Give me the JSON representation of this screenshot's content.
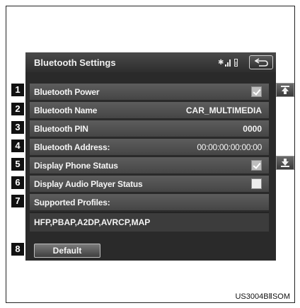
{
  "screen": {
    "title": "Bluetooth Settings",
    "status_icons": [
      "bluetooth-icon",
      "signal-icon",
      "battery-icon"
    ],
    "back_icon": "back-arrow-icon"
  },
  "rows": [
    {
      "num": "1",
      "label": "Bluetooth Power",
      "type": "checkbox",
      "checked": true
    },
    {
      "num": "2",
      "label": "Bluetooth Name",
      "type": "value",
      "value": "CAR_MULTIMEDIA"
    },
    {
      "num": "3",
      "label": "Bluetooth PIN",
      "type": "value",
      "value": "0000"
    },
    {
      "num": "4",
      "label": "Bluetooth Address:",
      "type": "value",
      "value": "00:00:00:00:00:00"
    },
    {
      "num": "5",
      "label": "Display Phone Status",
      "type": "checkbox",
      "checked": true
    },
    {
      "num": "6",
      "label": "Display Audio Player Status",
      "type": "checkbox",
      "checked": false
    },
    {
      "num": "7",
      "label": "Supported Profiles:",
      "type": "header"
    }
  ],
  "profiles_value": "HFP,PBAP,A2DP,AVRCP,MAP",
  "default_button": {
    "num": "8",
    "label": "Default"
  },
  "scroll": {
    "up_icon": "scroll-up-icon",
    "down_icon": "scroll-down-icon"
  },
  "caption": "US3004BⅡSOM",
  "colors": {
    "screen_bg": "#2a2a2a",
    "row_bg": "#525252",
    "text": "#f4f4f4"
  }
}
